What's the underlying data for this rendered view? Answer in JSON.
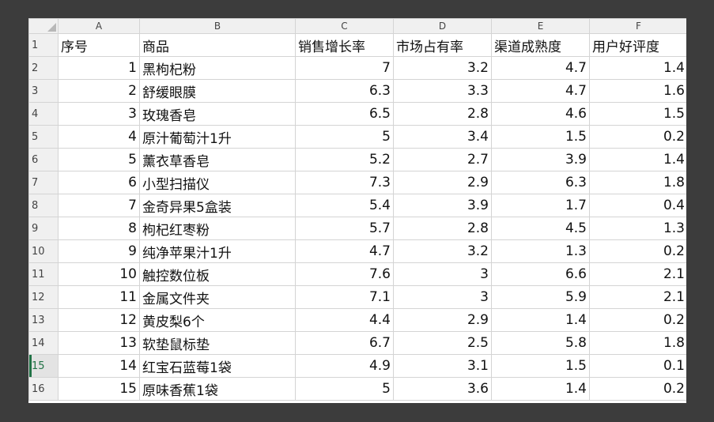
{
  "columns": [
    "A",
    "B",
    "C",
    "D",
    "E",
    "F"
  ],
  "header": {
    "row_num": "1",
    "cells": [
      "序号",
      "商品",
      "销售增长率",
      "市场占有率",
      "渠道成熟度",
      "用户好评度"
    ]
  },
  "rows": [
    {
      "row_num": "2",
      "cells": [
        "1",
        "黑枸杞粉",
        "7",
        "3.2",
        "4.7",
        "1.4"
      ]
    },
    {
      "row_num": "3",
      "cells": [
        "2",
        "舒缓眼膜",
        "6.3",
        "3.3",
        "4.7",
        "1.6"
      ]
    },
    {
      "row_num": "4",
      "cells": [
        "3",
        "玫瑰香皂",
        "6.5",
        "2.8",
        "4.6",
        "1.5"
      ]
    },
    {
      "row_num": "5",
      "cells": [
        "4",
        "原汁葡萄汁1升",
        "5",
        "3.4",
        "1.5",
        "0.2"
      ]
    },
    {
      "row_num": "6",
      "cells": [
        "5",
        "薰衣草香皂",
        "5.2",
        "2.7",
        "3.9",
        "1.4"
      ]
    },
    {
      "row_num": "7",
      "cells": [
        "6",
        "小型扫描仪",
        "7.3",
        "2.9",
        "6.3",
        "1.8"
      ]
    },
    {
      "row_num": "8",
      "cells": [
        "7",
        "金奇异果5盒装",
        "5.4",
        "3.9",
        "1.7",
        "0.4"
      ]
    },
    {
      "row_num": "9",
      "cells": [
        "8",
        "枸杞红枣粉",
        "5.7",
        "2.8",
        "4.5",
        "1.3"
      ]
    },
    {
      "row_num": "10",
      "cells": [
        "9",
        "纯净苹果汁1升",
        "4.7",
        "3.2",
        "1.3",
        "0.2"
      ]
    },
    {
      "row_num": "11",
      "cells": [
        "10",
        "触控数位板",
        "7.6",
        "3",
        "6.6",
        "2.1"
      ]
    },
    {
      "row_num": "12",
      "cells": [
        "11",
        "金属文件夹",
        "7.1",
        "3",
        "5.9",
        "2.1"
      ]
    },
    {
      "row_num": "13",
      "cells": [
        "12",
        "黄皮梨6个",
        "4.4",
        "2.9",
        "1.4",
        "0.2"
      ]
    },
    {
      "row_num": "14",
      "cells": [
        "13",
        "软垫鼠标垫",
        "6.7",
        "2.5",
        "5.8",
        "1.8"
      ]
    },
    {
      "row_num": "15",
      "cells": [
        "14",
        "红宝石蓝莓1袋",
        "4.9",
        "3.1",
        "1.5",
        "0.1"
      ]
    },
    {
      "row_num": "16",
      "cells": [
        "15",
        "原味香蕉1袋",
        "5",
        "3.6",
        "1.4",
        "0.2"
      ]
    }
  ],
  "active_row": "15",
  "colors": {
    "background": "#3c3c3c",
    "header_fill": "#f0f0f0",
    "gridline": "#d4d4d4",
    "active_indicator": "#217346"
  }
}
